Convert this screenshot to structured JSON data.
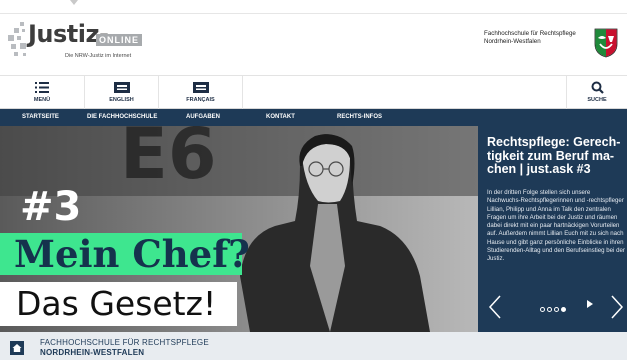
{
  "logo": {
    "name": "Justiz-",
    "badge": "ONLINE",
    "tagline": "Die NRW-Justiz im Internet"
  },
  "institution": {
    "line1": "Fachhochschule für Rechtspflege",
    "line2": "Nordrhein-Westfalen"
  },
  "nav": {
    "menu": "MENÜ",
    "english": "ENGLISH",
    "francais": "FRANÇAIS",
    "search": "SUCHE"
  },
  "menubar": [
    "STARTSEITE",
    "DIE FACHHOCHSCHULE",
    "AUFGABEN",
    "KONTAKT",
    "RECHTS-INFOS"
  ],
  "hero": {
    "number": "#3",
    "line1": "Mein Chef?",
    "line2": "Das Gesetz!"
  },
  "panel": {
    "title": "Rechtspflege: Gerech-tigkeit zum Beruf ma-chen | just.ask #3",
    "text": "In der dritten Folge stellen sich unsere Nachwuchs-Rechtspflegerinnen und -rechtspfleger Lillian, Philipp und Anna im Talk den zentralen Fragen um ihre Arbeit bei der Justiz und räumen dabei direkt mit ein paar hartnäckigen Vorurteilen auf. Außerdem nimmt Lillian Euch mit zu sich nach Hause und gibt ganz persönliche Einblicke in ihren Studierenden-Alltag und den Berufseinstieg bei der Justiz.",
    "slides_total": 4,
    "slide_active": 4
  },
  "footer": {
    "line1": "FACHHOCHSCHULE FÜR RECHTSPFLEGE",
    "line2": "NORDRHEIN-WESTFALEN"
  },
  "colors": {
    "navy": "#1e3a57",
    "green": "#3ee68f",
    "grey": "#a7aaad"
  }
}
